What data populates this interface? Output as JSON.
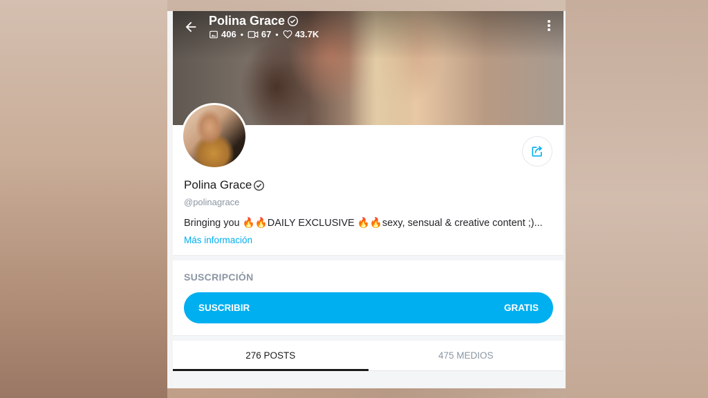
{
  "header": {
    "title": "Polina Grace",
    "stats": {
      "photos": "406",
      "videos": "67",
      "likes": "43.7K"
    },
    "icons": [
      "back-arrow-icon",
      "verified-icon",
      "image-icon",
      "video-icon",
      "heart-icon",
      "more-vertical-icon"
    ]
  },
  "profile": {
    "name": "Polina Grace",
    "handle": "@polinagrace",
    "bio": "Bringing you 🔥🔥DAILY EXCLUSIVE 🔥🔥sexy, sensual & creative content ;)...",
    "more_info": "Más información",
    "share_icon": "share-icon"
  },
  "subscription": {
    "heading": "SUSCRIPCIÓN",
    "button_label": "SUSCRIBIR",
    "price_label": "GRATIS"
  },
  "tabs": [
    {
      "label": "276 POSTS",
      "active": true
    },
    {
      "label": "475 MEDIOS",
      "active": false
    }
  ],
  "colors": {
    "accent": "#00aff0",
    "muted_text": "#8a96a3",
    "primary_text": "#1a1a1a"
  }
}
